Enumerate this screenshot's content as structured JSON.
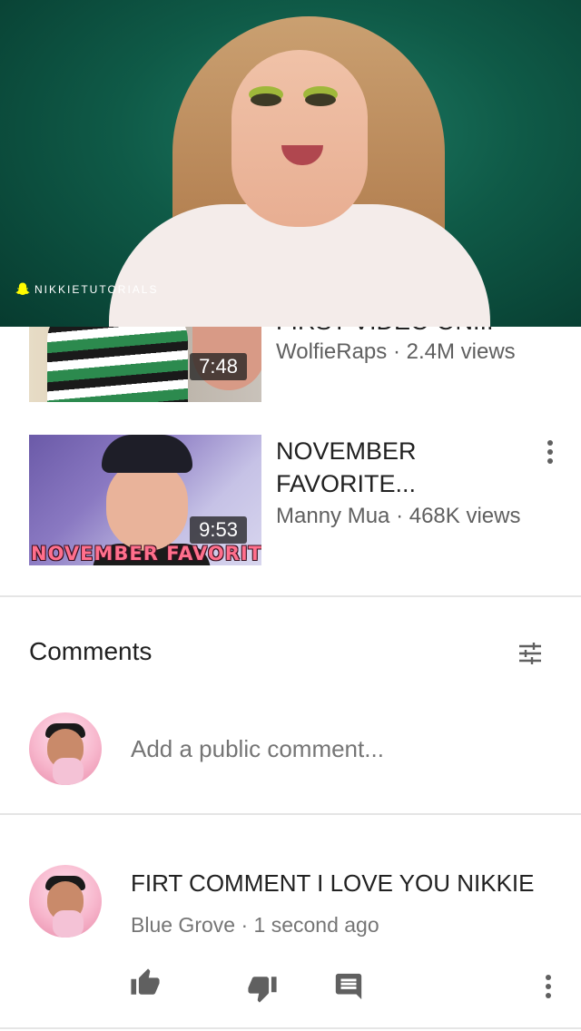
{
  "player": {
    "watermark": "NIKKIETUTORIALS",
    "watermark_icon": "snapchat-icon"
  },
  "related_videos": [
    {
      "title": "FIRST VIDEO ON...",
      "channel": "WolfieRaps",
      "views": "2.4M views",
      "duration": "7:48"
    },
    {
      "title_line1": "NOVEMBER",
      "title_line2": "FAVORITE...",
      "channel": "Manny Mua",
      "views": "468K views",
      "duration": "9:53",
      "thumbnail_text": "NOVEMBER FAVORITES",
      "menu_icon": "more-vert-icon"
    }
  ],
  "comments": {
    "header": "Comments",
    "sort_icon": "sort-filter-icon",
    "add_placeholder": "Add a public comment...",
    "items": [
      {
        "text": "FIRT COMMENT I LOVE YOU NIKKIE",
        "author": "Blue Grove",
        "time": "1 second ago",
        "actions": [
          "thumb-up-icon",
          "thumb-down-icon",
          "reply-icon",
          "more-vert-icon"
        ]
      }
    ]
  },
  "colors": {
    "primary_text": "#212121",
    "secondary_text": "#606060",
    "divider": "#e5e5e5",
    "player_background": "#0f5a47"
  }
}
